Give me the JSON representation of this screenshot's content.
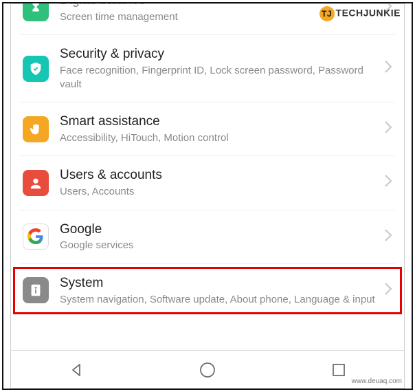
{
  "watermarks": {
    "top_badge": "TJ",
    "top_text": "TECHJUNKIE",
    "bottom_text": "www.deuaq.com"
  },
  "rows": {
    "digital": {
      "title": "Digital balance",
      "sub": "Screen time management"
    },
    "security": {
      "title": "Security & privacy",
      "sub": "Face recognition, Fingerprint ID, Lock screen password, Password vault"
    },
    "smart": {
      "title": "Smart assistance",
      "sub": "Accessibility, HiTouch, Motion control"
    },
    "users": {
      "title": "Users & accounts",
      "sub": "Users, Accounts"
    },
    "google": {
      "title": "Google",
      "sub": "Google services"
    },
    "system": {
      "title": "System",
      "sub": "System navigation, Software update, About phone, Language & input"
    }
  }
}
